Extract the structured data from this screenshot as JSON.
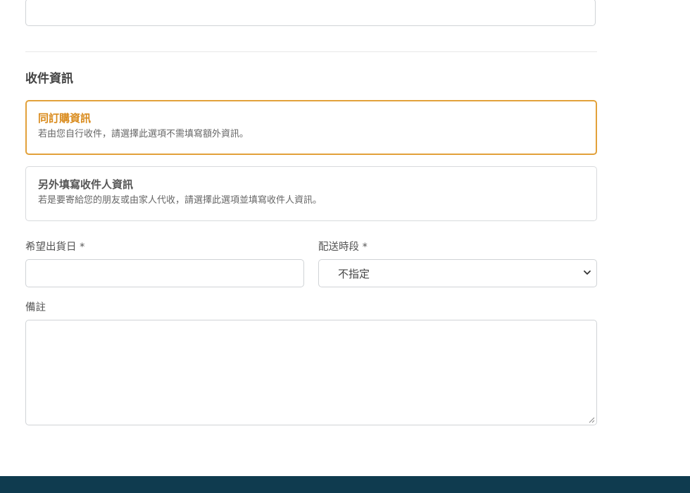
{
  "section": {
    "title": "收件資訊"
  },
  "recipient_options": [
    {
      "title": "同訂購資訊",
      "description": "若由您自行收件，請選擇此選項不需填寫額外資訊。",
      "selected": true
    },
    {
      "title": "另外填寫收件人資訊",
      "description": "若是要寄給您的朋友或由家人代收，請選擇此選項並填寫收件人資訊。",
      "selected": false
    }
  ],
  "form": {
    "ship_date_label": "希望出貨日 *",
    "ship_date_value": "",
    "time_slot_label": "配送時段 *",
    "time_slot_value": "不指定",
    "note_label": "備註",
    "note_value": ""
  },
  "colors": {
    "selected_accent": "#e2a13a",
    "footer_background": "#0f3b4f"
  }
}
